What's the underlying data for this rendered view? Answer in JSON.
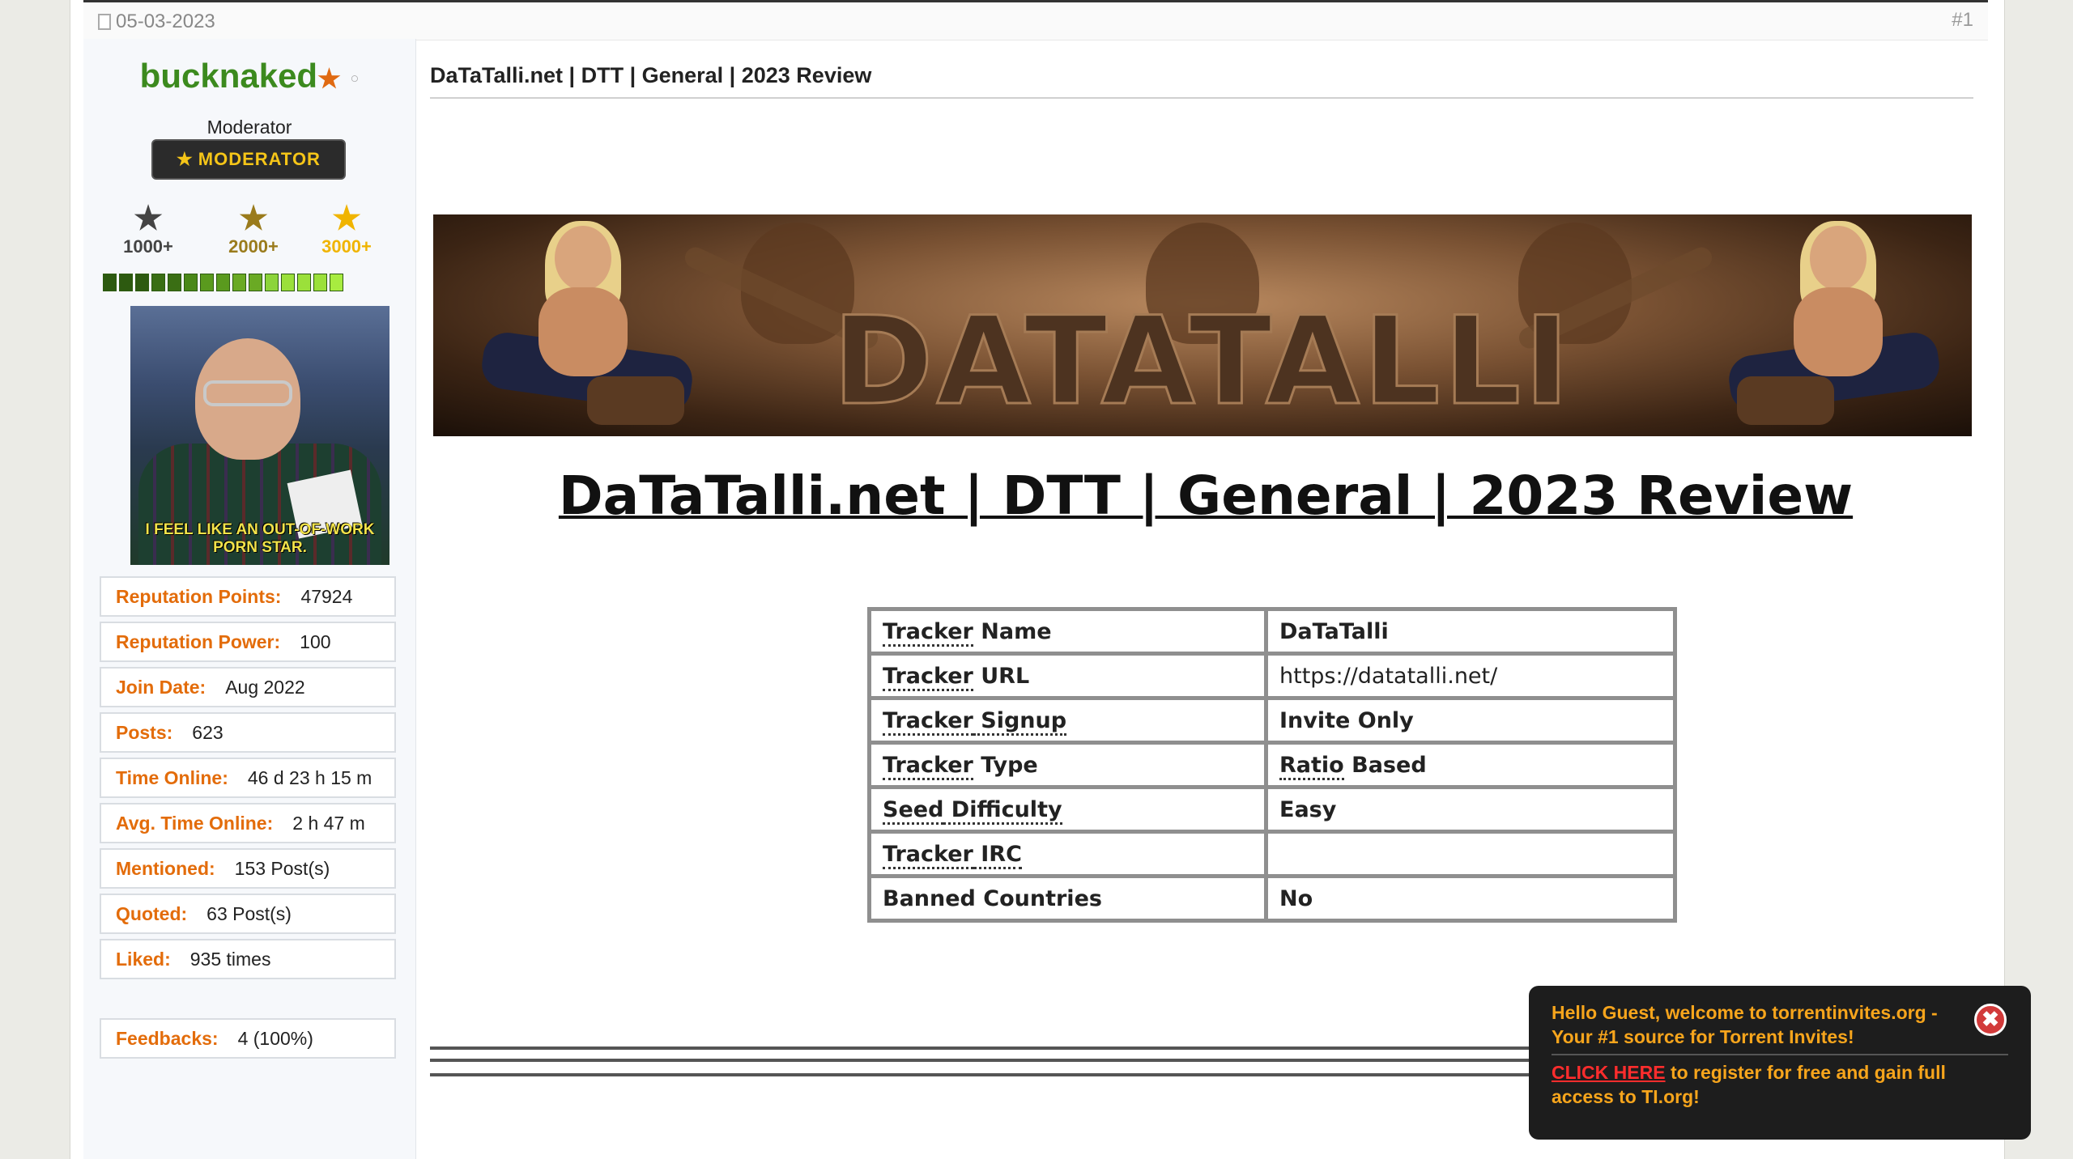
{
  "post": {
    "date": "05-03-2023",
    "number": "#1",
    "title": "DaTaTalli.net | DTT | General | 2023 Review",
    "heading": "DaTaTalli.net | DTT | General | 2023 Review"
  },
  "user": {
    "name": "bucknaked",
    "title": "Moderator",
    "badge": "MODERATOR",
    "awards": [
      {
        "label": "1000+",
        "color": "#444444"
      },
      {
        "label": "2000+",
        "color": "#9a7b1c"
      },
      {
        "label": "3000+",
        "color": "#f0b400"
      }
    ],
    "progress_colors": [
      "#2d5a10",
      "#2d5a10",
      "#2d5a10",
      "#3a6e14",
      "#3a6e14",
      "#4a8818",
      "#5a9a1e",
      "#5a9a1e",
      "#6aaa24",
      "#6aaa24",
      "#8cd43a",
      "#9be03a",
      "#9be03a",
      "#9be03a",
      "#a8ec40"
    ],
    "avatar_caption": "I FEEL LIKE AN OUT-OF-WORK PORN STAR.",
    "stats": [
      {
        "label": "Reputation Points:",
        "value": "47924"
      },
      {
        "label": "Reputation Power:",
        "value": "100"
      },
      {
        "label": "Join Date:",
        "value": "Aug 2022"
      },
      {
        "label": "Posts:",
        "value": "623"
      },
      {
        "label": "Time Online:",
        "value": "46 d 23 h 15 m"
      },
      {
        "label": "Avg. Time Online:",
        "value": "2 h 47 m"
      },
      {
        "label": "Mentioned:",
        "value": "153 Post(s)"
      },
      {
        "label": "Quoted:",
        "value": "63 Post(s)"
      },
      {
        "label": "Liked:",
        "value": "935 times"
      }
    ],
    "feedback": {
      "label": "Feedbacks:",
      "value": "4 (100%)"
    }
  },
  "banner": {
    "text": "DATATALLI"
  },
  "table": {
    "rows": [
      {
        "k1": "Tracker",
        "k2": " Name",
        "value": "DaTaTalli",
        "vb": true
      },
      {
        "k1": "Tracker",
        "k2": " URL",
        "value": "https://datatalli.net/",
        "vb": false
      },
      {
        "k1": "Tracker",
        "k2": " Signup",
        "value": "Invite Only",
        "vb": true
      },
      {
        "k1": "Tracker",
        "k2": " Type",
        "value": "Ratio",
        "value2": " Based",
        "vb": true
      },
      {
        "k1": "Seed",
        "k2": " Difficulty",
        "value": "Easy",
        "vb": true
      },
      {
        "k1": "Tracker",
        "k2": " IRC",
        "value": "",
        "vb": true
      },
      {
        "k1": "Banned Countries",
        "k2": "",
        "value": "No",
        "vb": true
      }
    ]
  },
  "toast": {
    "line1": "Hello Guest, welcome to torrentinvites.org - Your #1 source for Torrent Invites!",
    "cta": "CLICK HERE",
    "line2": " to register for free and gain full access to TI.org!",
    "close": "✖"
  },
  "colors": {
    "label": "#e36c0a",
    "username": "#3c8a1e",
    "toast_text": "#f7a51c"
  }
}
